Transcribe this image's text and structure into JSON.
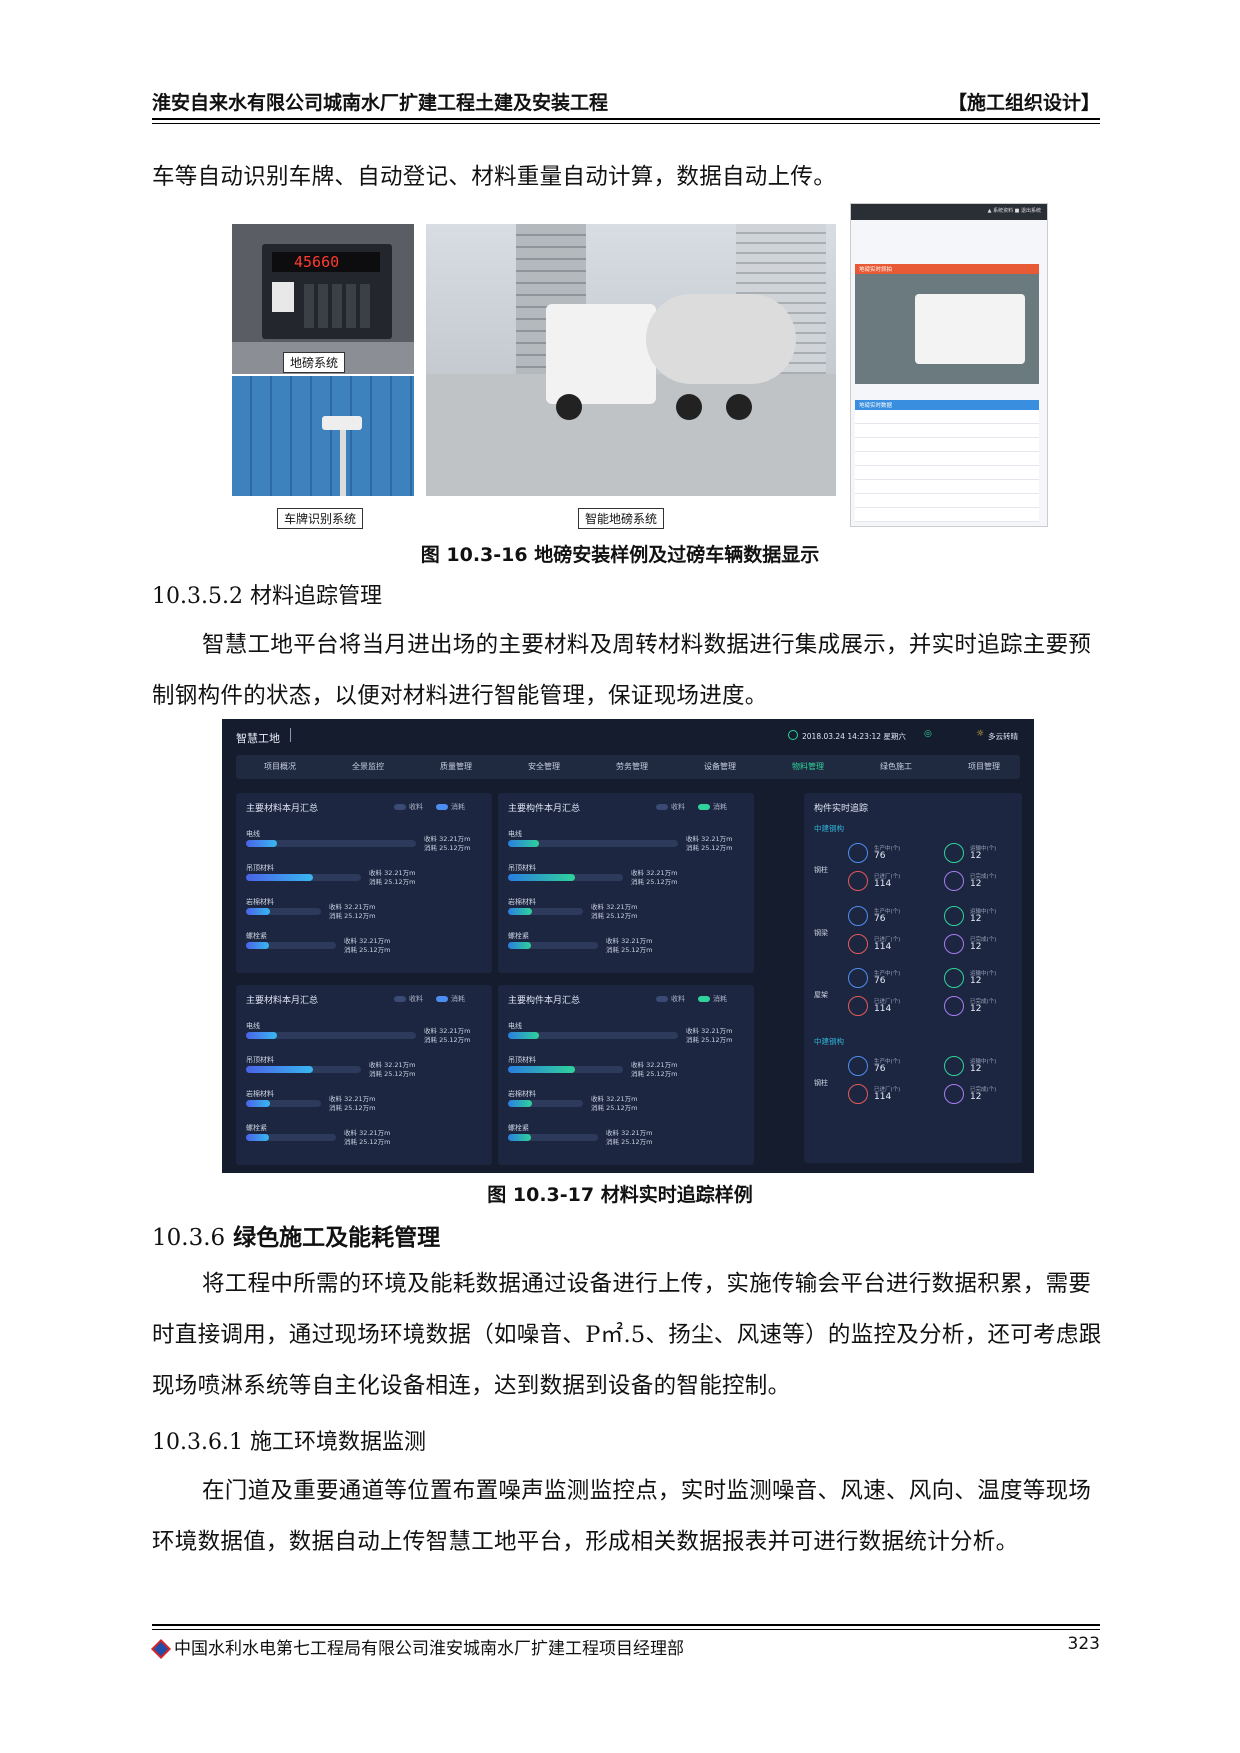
{
  "header": {
    "left": "淮安自来水有限公司城南水厂扩建工程土建及安装工程",
    "right": "【施工组织设计】"
  },
  "para1": "车等自动识别车牌、自动登记、材料重量自动计算，数据自动上传。",
  "figure16": {
    "scale_display": "45660",
    "label_dibang": "地磅系统",
    "label_chepai": "车牌识别系统",
    "label_zhineng": "智能地磅系统",
    "screen_top_links": [
      "▲ 系统资料",
      "■ 退出系统"
    ],
    "screen_photo_title": "地磅实时抓拍",
    "screen_table_title": "地磅实时数据",
    "caption": "图 10.3-16  地磅安装样例及过磅车辆数据显示"
  },
  "sec_10_3_5_2": "10.3.5.2  材料追踪管理",
  "para2": "智慧工地平台将当月进出场的主要材料及周转材料数据进行集成展示，并实时追踪主要预制钢构件的状态，以便对材料进行智能管理，保证现场进度。",
  "dashboard": {
    "title": "智慧工地",
    "datetime": "2018.03.24  14:23:12  星期六",
    "weather": "多云转晴",
    "nav": [
      "项目概况",
      "全景监控",
      "质量管理",
      "安全管理",
      "劳务管理",
      "设备管理",
      "物料管理",
      "绿色施工",
      "项目管理"
    ],
    "active_nav": "物料管理",
    "legend": [
      "收料",
      "消耗"
    ],
    "panels": [
      {
        "title": "主要材料本月汇总",
        "kind": "blue"
      },
      {
        "title": "主要构件本月汇总",
        "kind": "green"
      },
      {
        "title": "主要材料本月汇总",
        "kind": "blue"
      },
      {
        "title": "主要构件本月汇总",
        "kind": "green"
      }
    ],
    "rows": [
      "电线",
      "吊顶材料",
      "岩棉材料",
      "螺栓紧"
    ],
    "row_fill": [
      0.18,
      0.58,
      0.32,
      0.26
    ],
    "recv": "收料  32.21万m",
    "cons": "消耗  25.12万m",
    "recv_alt": "收料  32.21万m",
    "cons_alt": "消耗  25.12万m",
    "tracking": {
      "title": "构件实时追踪",
      "group1": "中建钢构",
      "group2": "中建钢构",
      "items": [
        "钢柱",
        "钢梁",
        "屋架",
        "钢柱"
      ],
      "labels": {
        "producing": "生产中(个)",
        "shipping": "运输中(个)",
        "arrived": "已进厂(个)",
        "done": "已完成(个)"
      },
      "values": {
        "producing": "76",
        "shipping": "12",
        "arrived": "114",
        "done": "12"
      }
    }
  },
  "caption17": "图 10.3-17  材料实时追踪样例",
  "sec_10_3_6": {
    "num": "10.3.6",
    "title": "绿色施工及能耗管理"
  },
  "para3": "将工程中所需的环境及能耗数据通过设备进行上传，实施传输会平台进行数据积累，需要时直接调用，通过现场环境数据（如噪音、P㎡.5、扬尘、风速等）的监控及分析，还可考虑跟现场喷淋系统等自主化设备相连，达到数据到设备的智能控制。",
  "sec_10_3_6_1": "10.3.6.1  施工环境数据监测",
  "para4": "在门道及重要通道等位置布置噪声监测监控点，实时监测噪音、风速、风向、温度等现场环境数据值，数据自动上传智慧工地平台，形成相关数据报表并可进行数据统计分析。",
  "footer": {
    "left": "中国水利水电第七工程局有限公司淮安城南水厂扩建工程项目经理部",
    "page": "323"
  },
  "colors": {
    "accent_blue": "#4d8df0",
    "accent_green": "#2fd29a",
    "dash_bg": "#151c2e",
    "panel_bg": "#1d2640"
  }
}
